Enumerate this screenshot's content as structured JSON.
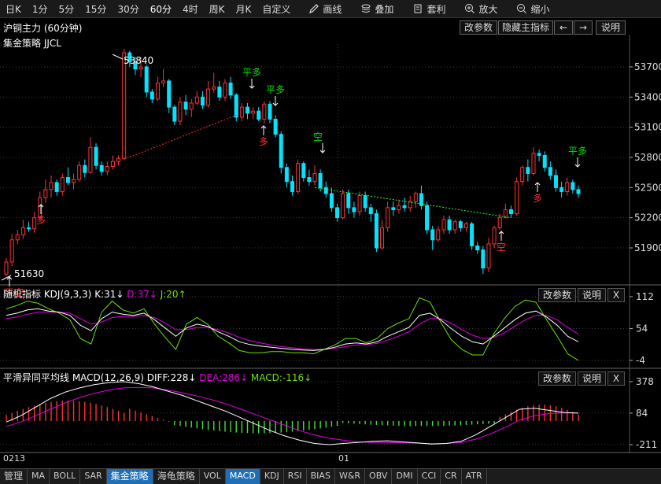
{
  "toolbar": {
    "timeframes": [
      "日K",
      "1分",
      "5分",
      "15分",
      "30分",
      "60分",
      "4时",
      "周K",
      "月K",
      "自定义"
    ],
    "active_timeframe": "60分",
    "tools": [
      {
        "label": "画线",
        "icon": "pencil-icon"
      },
      {
        "label": "叠加",
        "icon": "stack-icon"
      },
      {
        "label": "套利",
        "icon": "arbitrage-icon"
      },
      {
        "label": "放大",
        "icon": "zoom-in-icon"
      },
      {
        "label": "缩小",
        "icon": "zoom-out-icon"
      }
    ]
  },
  "header": {
    "title": "沪铜主力 (60分钟)",
    "buttons": {
      "modify": "改参数",
      "hide": "隐藏主指标",
      "left": "←",
      "right": "→",
      "help": "说明"
    }
  },
  "main_pane": {
    "strategy": "集金策略 JJCL",
    "price_ticks": [
      "53700",
      "53400",
      "53100",
      "52800",
      "52500",
      "52200",
      "51900"
    ],
    "high_label": "53840",
    "low_label": "51630",
    "signals": [
      {
        "text": "多",
        "color": "#ff3030"
      },
      {
        "text": "平多",
        "color": "#00e000"
      },
      {
        "text": "平多",
        "color": "#00e000"
      },
      {
        "text": "多",
        "color": "#ff3030"
      },
      {
        "text": "空",
        "color": "#00e000"
      },
      {
        "text": "空",
        "color": "#ff3030"
      },
      {
        "text": "多",
        "color": "#ff3030"
      },
      {
        "text": "平多",
        "color": "#00e000"
      },
      {
        "text": "平空",
        "color": "#ff3030"
      }
    ]
  },
  "kdj_pane": {
    "title": "随机指标 KDJ(9,3,3)",
    "k": "K:31↓",
    "d": "D:37↓",
    "j": "J:20↑",
    "ticks": [
      "112",
      "54",
      "-4"
    ],
    "buttons": {
      "modify": "改参数",
      "help": "说明",
      "close": "X"
    }
  },
  "macd_pane": {
    "title": "平滑异同平均线 MACD(12,26,9)",
    "diff": "DIFF:228↓",
    "dea": "DEA:286↓",
    "macd": "MACD:-116↓",
    "ticks": [
      "378",
      "84",
      "-211"
    ],
    "buttons": {
      "modify": "改参数",
      "help": "说明",
      "close": "X"
    }
  },
  "x_axis": {
    "start": "0213",
    "mid": "01"
  },
  "bottom_tabs": [
    "管理",
    "MA",
    "BOLL",
    "SAR",
    "集金策略",
    "海龟策略",
    "VOL",
    "MACD",
    "KDJ",
    "RSI",
    "BIAS",
    "W&R",
    "OBV",
    "DMI",
    "CCI",
    "CR",
    "ATR"
  ],
  "active_tabs": [
    "集金策略",
    "MACD"
  ],
  "colors": {
    "up": "#ff3232",
    "down": "#00e5ff",
    "k_line": "#ffffff",
    "d_line": "#e000e0",
    "j_line": "#70e000",
    "grid": "#3a3a3a",
    "active_tab": "#1e6fb5"
  }
}
